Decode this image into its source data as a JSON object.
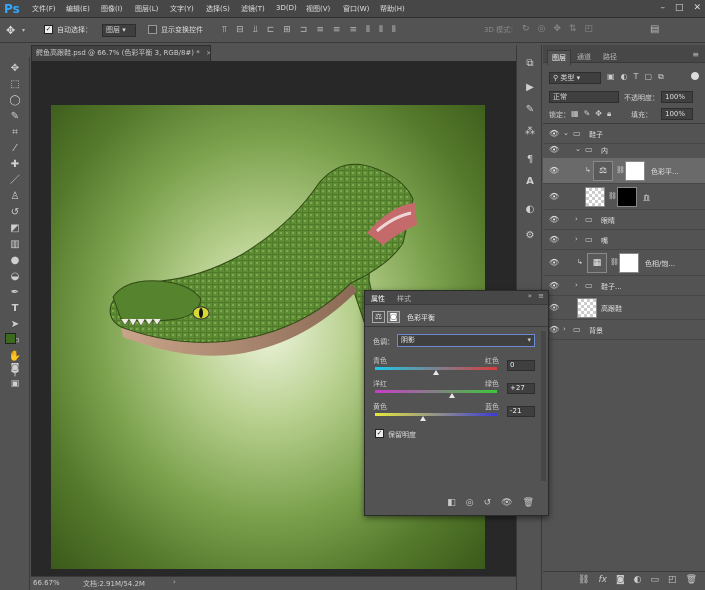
{
  "app": {
    "logo": "Ps"
  },
  "menu": [
    "文件(F)",
    "编辑(E)",
    "图像(I)",
    "图层(L)",
    "文字(Y)",
    "选择(S)",
    "滤镜(T)",
    "3D(D)",
    "视图(V)",
    "窗口(W)",
    "帮助(H)"
  ],
  "options": {
    "auto_select_label": "自动选择：",
    "auto_select_value": "图层",
    "show_transform_label": "显示变换控件",
    "mode3d_label": "3D 模式："
  },
  "document": {
    "tab_title": "鳄鱼高跟鞋.psd @ 66.7% (色彩平衡 3, RGB/8#) *",
    "zoom": "66.67%",
    "doc_size": "文档:2.91M/54.2M"
  },
  "layers_panel": {
    "tabs": [
      "图层",
      "通道",
      "路径"
    ],
    "filter_type": "类型",
    "blend_mode": "正常",
    "opacity_label": "不透明度：",
    "opacity": "100%",
    "lock_label": "锁定：",
    "fill_label": "填充：",
    "fill": "100%",
    "layers": [
      "鞋子",
      "内",
      "色彩平...",
      "血",
      "眼睛",
      "嘴",
      "色相/饱...",
      "鞋子...",
      "高跟鞋",
      "背景"
    ]
  },
  "properties": {
    "tabs": [
      "属性",
      "样式"
    ],
    "title": "色彩平衡",
    "tone_label": "色调：",
    "tone_value": "阴影",
    "sliders": [
      {
        "left": "青色",
        "right": "红色",
        "value": "0",
        "level": 0
      },
      {
        "left": "洋红",
        "right": "绿色",
        "value": "+27",
        "level": 27
      },
      {
        "left": "黄色",
        "right": "蓝色",
        "value": "-21",
        "level": -21
      }
    ],
    "preserve_label": "保留明度",
    "preserve_checked": true
  },
  "colors": {
    "fg": "#3d6b1e",
    "bg": "#ffffff"
  }
}
